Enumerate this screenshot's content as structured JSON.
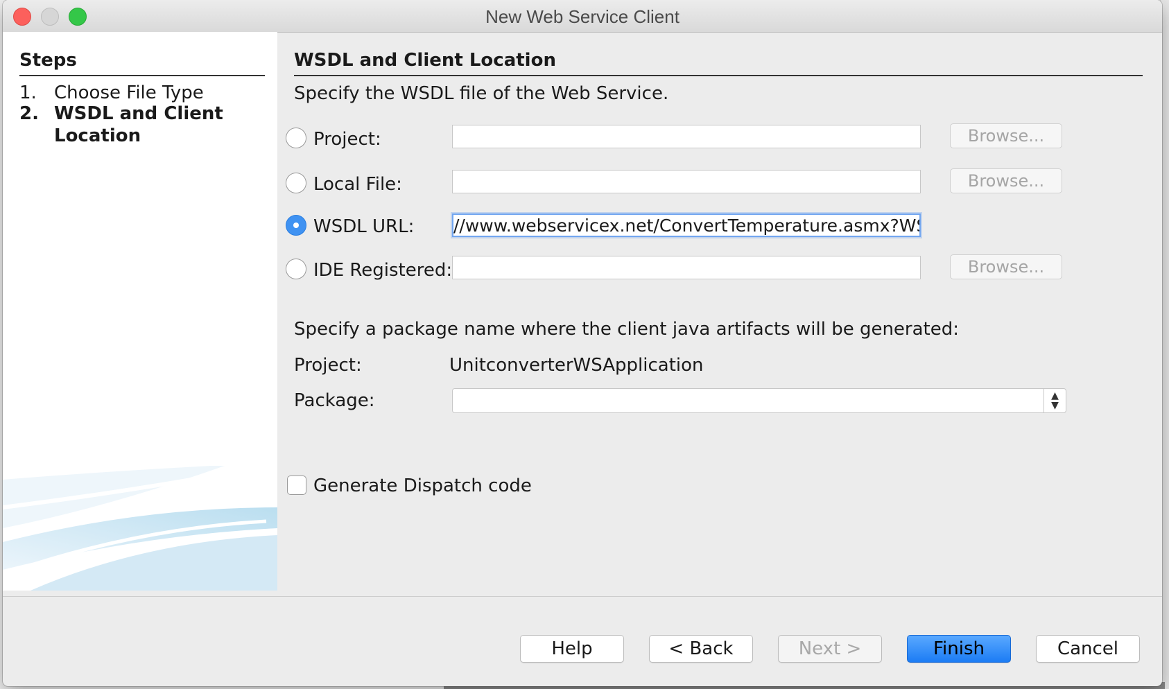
{
  "window": {
    "title": "New Web Service Client"
  },
  "steps": {
    "heading": "Steps",
    "items": [
      {
        "num": "1.",
        "label": "Choose File Type"
      },
      {
        "num": "2.",
        "label": "WSDL and Client Location"
      }
    ]
  },
  "main": {
    "section_title": "WSDL and Client Location",
    "instruction": "Specify the WSDL file of the Web Service.",
    "sources": [
      {
        "label": "Project:",
        "value": "",
        "browse_label": "Browse...",
        "selected": false
      },
      {
        "label": "Local File:",
        "value": "",
        "browse_label": "Browse...",
        "selected": false
      },
      {
        "label": "WSDL URL:",
        "value": "//www.webservicex.net/ConvertTemperature.asmx?WSDL",
        "selected": true
      },
      {
        "label": "IDE Registered:",
        "value": "",
        "browse_label": "Browse...",
        "selected": false
      }
    ],
    "package_instruction": "Specify a package name where the client java artifacts will be generated:",
    "project_label": "Project:",
    "project_value": "UnitconverterWSApplication",
    "package_label": "Package:",
    "package_value": "",
    "dispatch_label": "Generate Dispatch code",
    "dispatch_checked": false
  },
  "footer": {
    "help": "Help",
    "back": "< Back",
    "next": "Next >",
    "finish": "Finish",
    "cancel": "Cancel"
  },
  "colors": {
    "accent": "#3f92f2",
    "default_button": "#1c7cf4"
  }
}
